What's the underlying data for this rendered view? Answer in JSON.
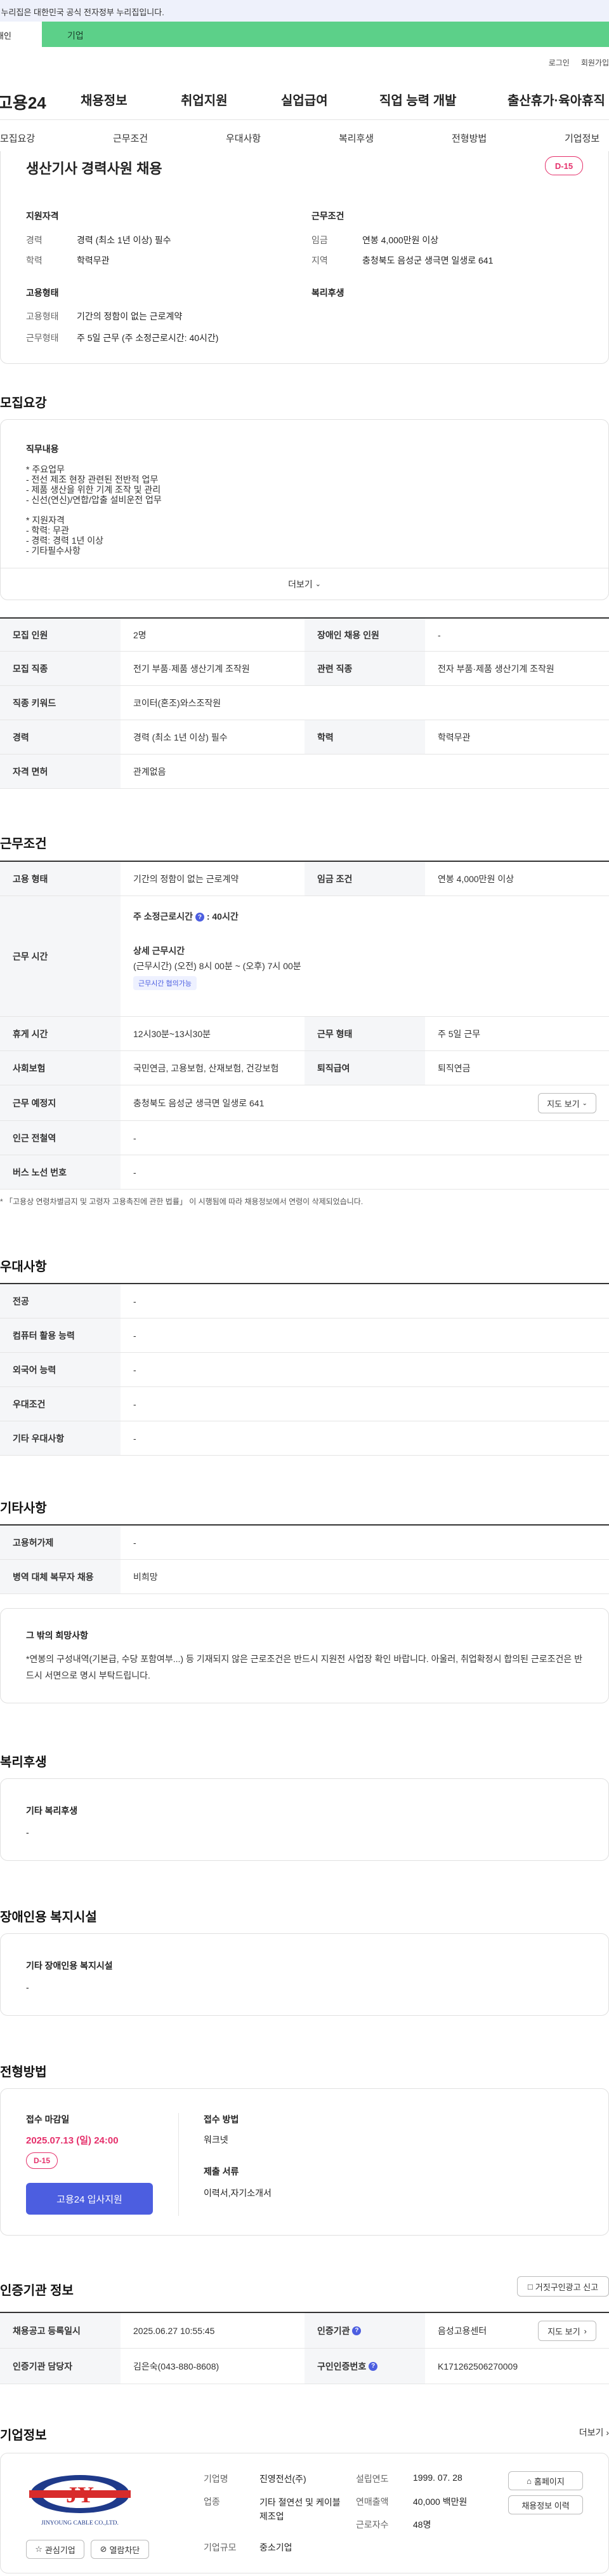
{
  "gov_banner": "이 누리집은 대한민국 공식 전자정부 누리집입니다.",
  "topbar": {
    "left": "개인",
    "right": "기업"
  },
  "util": {
    "login": "로그인",
    "join": "회원가입"
  },
  "gnb": {
    "logo": "고용24",
    "menu": [
      "채용정보",
      "취업지원",
      "실업급여",
      "직업 능력 개발",
      "출산휴가·육아휴직"
    ]
  },
  "tabs": [
    "모집요강",
    "근무조건",
    "우대사항",
    "복리후생",
    "전형방법",
    "기업정보"
  ],
  "summary": {
    "title": "생산기사 경력사원 채용",
    "dday": "D-15",
    "qual_head": "지원자격",
    "cond_head": "근무조건",
    "career_l": "경력",
    "career_v": "경력 (최소 1년 이상) 필수",
    "edu_l": "학력",
    "edu_v": "학력무관",
    "wage_l": "임금",
    "wage_v": "연봉 4,000만원 이상",
    "area_l": "지역",
    "area_v": "충청북도 음성군 생극면 일생로 641",
    "emp_head": "고용형태",
    "welfare_head": "복리후생",
    "type_l": "고용형태",
    "type_v": "기간의 정함이 없는 근로계약",
    "work_l": "근무형태",
    "work_v": "주 5일 근무 (주 소정근로시간: 40시간)"
  },
  "recruit": {
    "heading": "모집요강",
    "duty_head": "직무내용",
    "lines": [
      "* 주요업무",
      "- 전선 제조 현장 관련된 전반적 업무",
      "- 제품 생산을 위한 기계 조작 및 관리",
      "- 신선(연신)/연합/압출 설비운전 업무",
      "",
      "* 지원자격",
      "- 학력: 무관",
      "- 경력: 경력 1년 이상",
      "- 기타필수사항"
    ],
    "more": "더보기",
    "rows": [
      {
        "th": "모집 인원",
        "td": "2명",
        "th2": "장애인 채용 인원",
        "td2": "-"
      },
      {
        "th": "모집 직종",
        "td": "전기 부품·제품 생산기계 조작원",
        "th2": "관련 직종",
        "td2": "전자 부품·제품 생산기계 조작원"
      },
      {
        "th": "직종 키워드",
        "td": "코이터(혼조)와스조작원"
      },
      {
        "th": "경력",
        "td": "경력 (최소 1년 이상) 필수",
        "th2": "학력",
        "td2": "학력무관"
      },
      {
        "th": "자격 면허",
        "td": "관계없음"
      }
    ]
  },
  "work": {
    "heading": "근무조건",
    "type_th": "고용 형태",
    "type_td": "기간의 정함이 없는 근로계약",
    "wage_th": "임금 조건",
    "wage_td": "연봉 4,000만원 이상",
    "hours_th": "근무 시간",
    "hours_main": "주 소정근로시간",
    "hours_val": ": 40시간",
    "detail_head": "상세 근무시간",
    "detail_val": "(근무시간) (오전) 8시 00분 ~ (오후) 7시 00분",
    "flex_tag": "근무시간 협의가능",
    "break_th": "휴게 시간",
    "break_td": "12시30분~13시30분",
    "form_th": "근무 형태",
    "form_td": "주 5일 근무",
    "ins_th": "사회보험",
    "ins_td": "국민연금, 고용보험, 산재보험, 건강보험",
    "ret_th": "퇴직급여",
    "ret_td": "퇴직연금",
    "loc_th": "근무 예정지",
    "loc_td": "충청북도 음성군 생극면 일생로 641",
    "map_btn": "지도 보기",
    "subway_th": "인근 전철역",
    "subway_td": "-",
    "bus_th": "버스 노선 번호",
    "bus_td": "-",
    "notice": "* 「고용상 연령차별금지 및 고령자 고용촉진에 관한 법률」 이 시행됨에 따라 채용정보에서 연령이 삭제되었습니다."
  },
  "pref": {
    "heading": "우대사항",
    "rows": [
      {
        "th": "전공",
        "td": "-"
      },
      {
        "th": "컴퓨터 활용 능력",
        "td": "-"
      },
      {
        "th": "외국어 능력",
        "td": "-"
      },
      {
        "th": "우대조건",
        "td": "-"
      },
      {
        "th": "기타 우대사항",
        "td": "-"
      }
    ]
  },
  "etc": {
    "heading": "기타사항",
    "rows": [
      {
        "th": "고용허가제",
        "td": "-"
      },
      {
        "th": "병역 대체 복무자 채용",
        "td": "비희망"
      }
    ],
    "other_head": "그 밖의 희망사항",
    "other_text": "*연봉의 구성내역(기본급, 수당 포함여부...) 등 기재되지 않은 근로조건은 반드시 지원전 사업장 확인 바랍니다. 아울러, 취업확정시 합의된 근로조건은 반드시 서면으로 명시 부탁드립니다."
  },
  "welfare": {
    "heading": "복리후생",
    "sub": "기타 복리후생",
    "val": "-"
  },
  "disab": {
    "heading": "장애인용 복지시설",
    "sub": "기타 장애인용 복지시설",
    "val": "-"
  },
  "selection": {
    "heading": "전형방법",
    "deadline_l": "접수 마감일",
    "deadline_v": "2025.07.13 (일) 24:00",
    "dday": "D-15",
    "apply": "고용24 입사지원",
    "method_l": "접수 방법",
    "method_v": "워크넷",
    "docs_l": "제출 서류",
    "docs_v": "이력서,자기소개서"
  },
  "cert": {
    "heading": "인증기관 정보",
    "report_btn": "거짓구인광고 신고",
    "reg_th": "채용공고 등록일시",
    "reg_td": "2025.06.27 10:55:45",
    "org_th": "인증기관",
    "org_td": "음성고용센터",
    "map_btn": "지도 보기",
    "mgr_th": "인증기관 담당자",
    "mgr_td": "김은숙(043-880-8608)",
    "num_th": "구인인증번호",
    "num_td": "K171262506270009"
  },
  "company": {
    "heading": "기업정보",
    "more": "더보기",
    "logo_text": "JY",
    "logo_sub": "JINYOUNG CABLE CO.,LTD.",
    "fav": "관심기업",
    "block": "열람차단",
    "name_l": "기업명",
    "name_v": "진영전선(주)",
    "ind_l": "업종",
    "ind_v": "기타 절연선 및 케이블 제조업",
    "size_l": "기업규모",
    "size_v": "중소기업",
    "est_l": "설립연도",
    "est_v": "1999. 07. 28",
    "sales_l": "연매출액",
    "sales_v": "40,000 백만원",
    "emp_l": "근로자수",
    "emp_v": "48명",
    "home_btn": "홈페이지",
    "jobs_btn": "채용정보 이력"
  },
  "colors": {
    "accent": "#4c5ee0",
    "dday": "#e5306b",
    "green": "#5cd089"
  }
}
